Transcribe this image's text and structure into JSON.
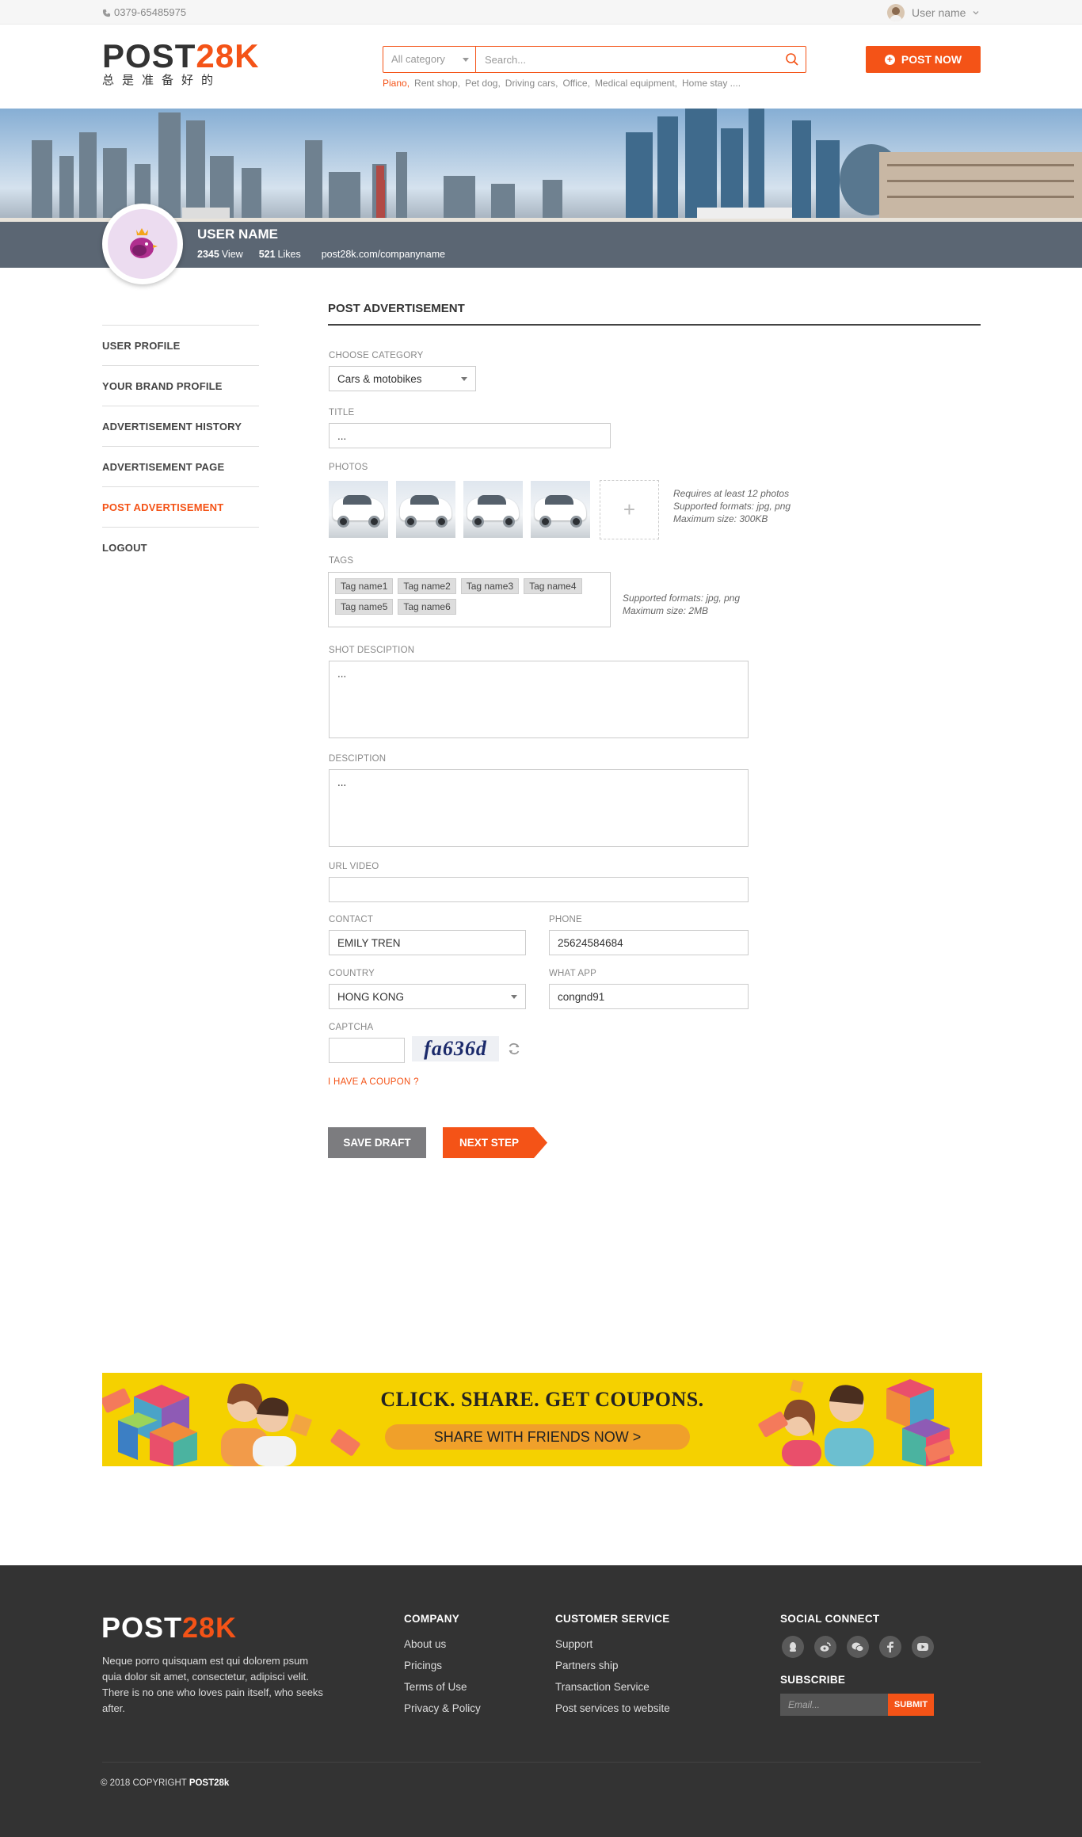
{
  "topbar": {
    "phone": "0379-65485975",
    "user": "User name"
  },
  "header": {
    "logo_a": "POST",
    "logo_b": "28K",
    "slogan": "总是准备好的",
    "category": "All category",
    "search_placeholder": "Search...",
    "suggestions": [
      "Piano,",
      "Rent shop,",
      "Pet dog,",
      "Driving cars,",
      "Office,",
      "Medical equipment,",
      "Home stay ...."
    ],
    "post_now": "POST NOW"
  },
  "profile": {
    "name": "USER NAME",
    "views": "2345",
    "views_label": "View",
    "likes": "521",
    "likes_label": "Likes",
    "url": "post28k.com/companyname"
  },
  "sidebar": {
    "items": [
      {
        "label": "USER PROFILE"
      },
      {
        "label": "YOUR BRAND  PROFILE"
      },
      {
        "label": "ADVERTISEMENT HISTORY"
      },
      {
        "label": "ADVERTISEMENT PAGE"
      },
      {
        "label": "POST ADVERTISEMENT"
      },
      {
        "label": "LOGOUT"
      }
    ],
    "active": "POST ADVERTISEMENT"
  },
  "form": {
    "title": "POST ADVERTISEMENT",
    "category_label": "CHOOSE CATEGORY",
    "category_value": "Cars & motobikes",
    "title_label": "TITLE",
    "title_value": "...",
    "photos_label": "PHOTOS",
    "photo_add": "+",
    "photo_notes": [
      "Requires at least 12 photos",
      "Supported formats: jpg, png",
      "Maximum size: 300KB"
    ],
    "tags_label": "TAGS",
    "tags": [
      "Tag name1",
      "Tag name2",
      "Tag name3",
      "Tag name4",
      "Tag name5",
      "Tag name6"
    ],
    "tag_notes": [
      "Supported formats: jpg, png",
      "Maximum size: 2MB"
    ],
    "short_label": "SHOT DESCIPTION",
    "short_value": "...",
    "desc_label": "DESCIPTION",
    "desc_value": "...",
    "url_label": "URL VIDEO",
    "url_value": "",
    "contact_label": "CONTACT",
    "contact_value": "EMILY TREN",
    "phone_label": "PHONE",
    "phone_value": "25624584684",
    "country_label": "COUNTRY",
    "country_value": "HONG KONG",
    "whatapp_label": "WHAT APP",
    "whatapp_value": "congnd91",
    "captcha_label": "CAPTCHA",
    "captcha_text": "fa636d",
    "coupon": "I HAVE A COUPON ?",
    "save_draft": "SAVE DRAFT",
    "next_step": "NEXT STEP"
  },
  "ad": {
    "headline": "CLICK. SHARE. GET COUPONS.",
    "button": "SHARE WITH FRIENDS NOW  >"
  },
  "footer": {
    "logo_a": "POST",
    "logo_b": "28K",
    "desc": "Neque porro quisquam est qui dolorem psum quia dolor sit amet, consectetur, adipisci velit. There is no one who loves pain itself, who seeks after.",
    "company_head": "COMPANY",
    "company_links": [
      "About us",
      "Pricings",
      "Terms of Use",
      "Privacy & Policy"
    ],
    "service_head": "CUSTOMER SERVICE",
    "service_links": [
      "Support",
      "Partners ship",
      "Transaction Service",
      "Post services to website"
    ],
    "social_head": "SOCIAL CONNECT",
    "social_icons": [
      "qq-icon",
      "weibo-icon",
      "wechat-icon",
      "facebook-icon",
      "youtube-icon"
    ],
    "subscribe_head": "SUBSCRIBE",
    "email_placeholder": "Email...",
    "submit": "SUBMIT",
    "copyright_pre": "© 2018 COPYRIGHT ",
    "copyright_brand": "POST28k"
  },
  "colors": {
    "accent": "#f45317",
    "footer_bg": "#333333",
    "ad_bg": "#f5d100"
  }
}
